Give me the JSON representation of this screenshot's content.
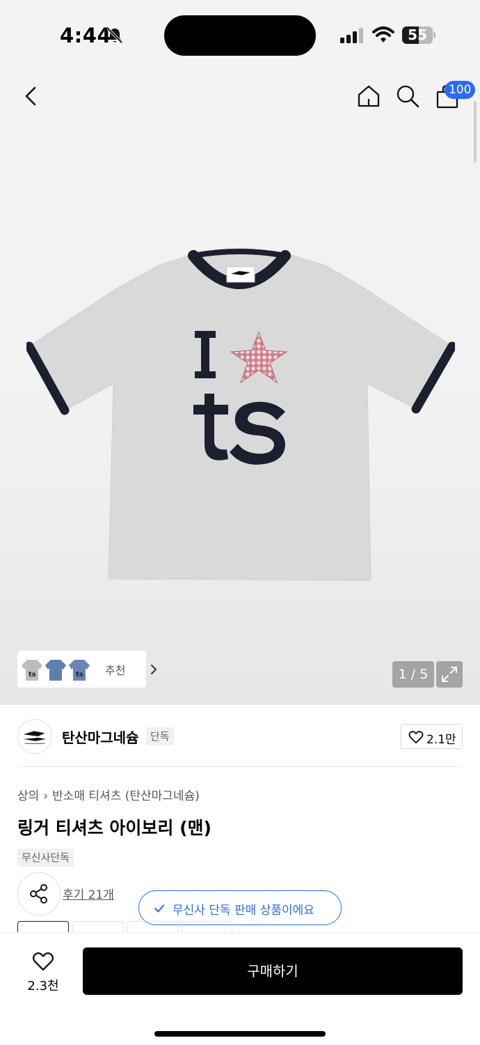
{
  "status": {
    "time": "4:44",
    "battery": "55",
    "battery_level": 0.55
  },
  "header": {
    "cart_count": "100",
    "icons": [
      "back-icon",
      "home-icon",
      "search-icon",
      "cart-icon"
    ]
  },
  "gallery": {
    "recommend_label": "추천",
    "counter": "1 / 5"
  },
  "brand": {
    "name": "탄산마그네슘",
    "tag": "단독",
    "likes": "2.1만"
  },
  "product": {
    "breadcrumb": [
      "상의",
      "반소매 티셔츠 (탄산마그네슘)"
    ],
    "title": "링거 티셔츠 아이보리 (맨)",
    "exclusive_tag": "무신사단독",
    "reviews": "후기 21개",
    "tooltip": "무신사 단독 판매 상품이에요"
  },
  "bottom": {
    "wish_count": "2.3천",
    "buy_label": "구매하기"
  },
  "colors": {
    "accent": "#2b6bf3",
    "button": "#000000"
  }
}
